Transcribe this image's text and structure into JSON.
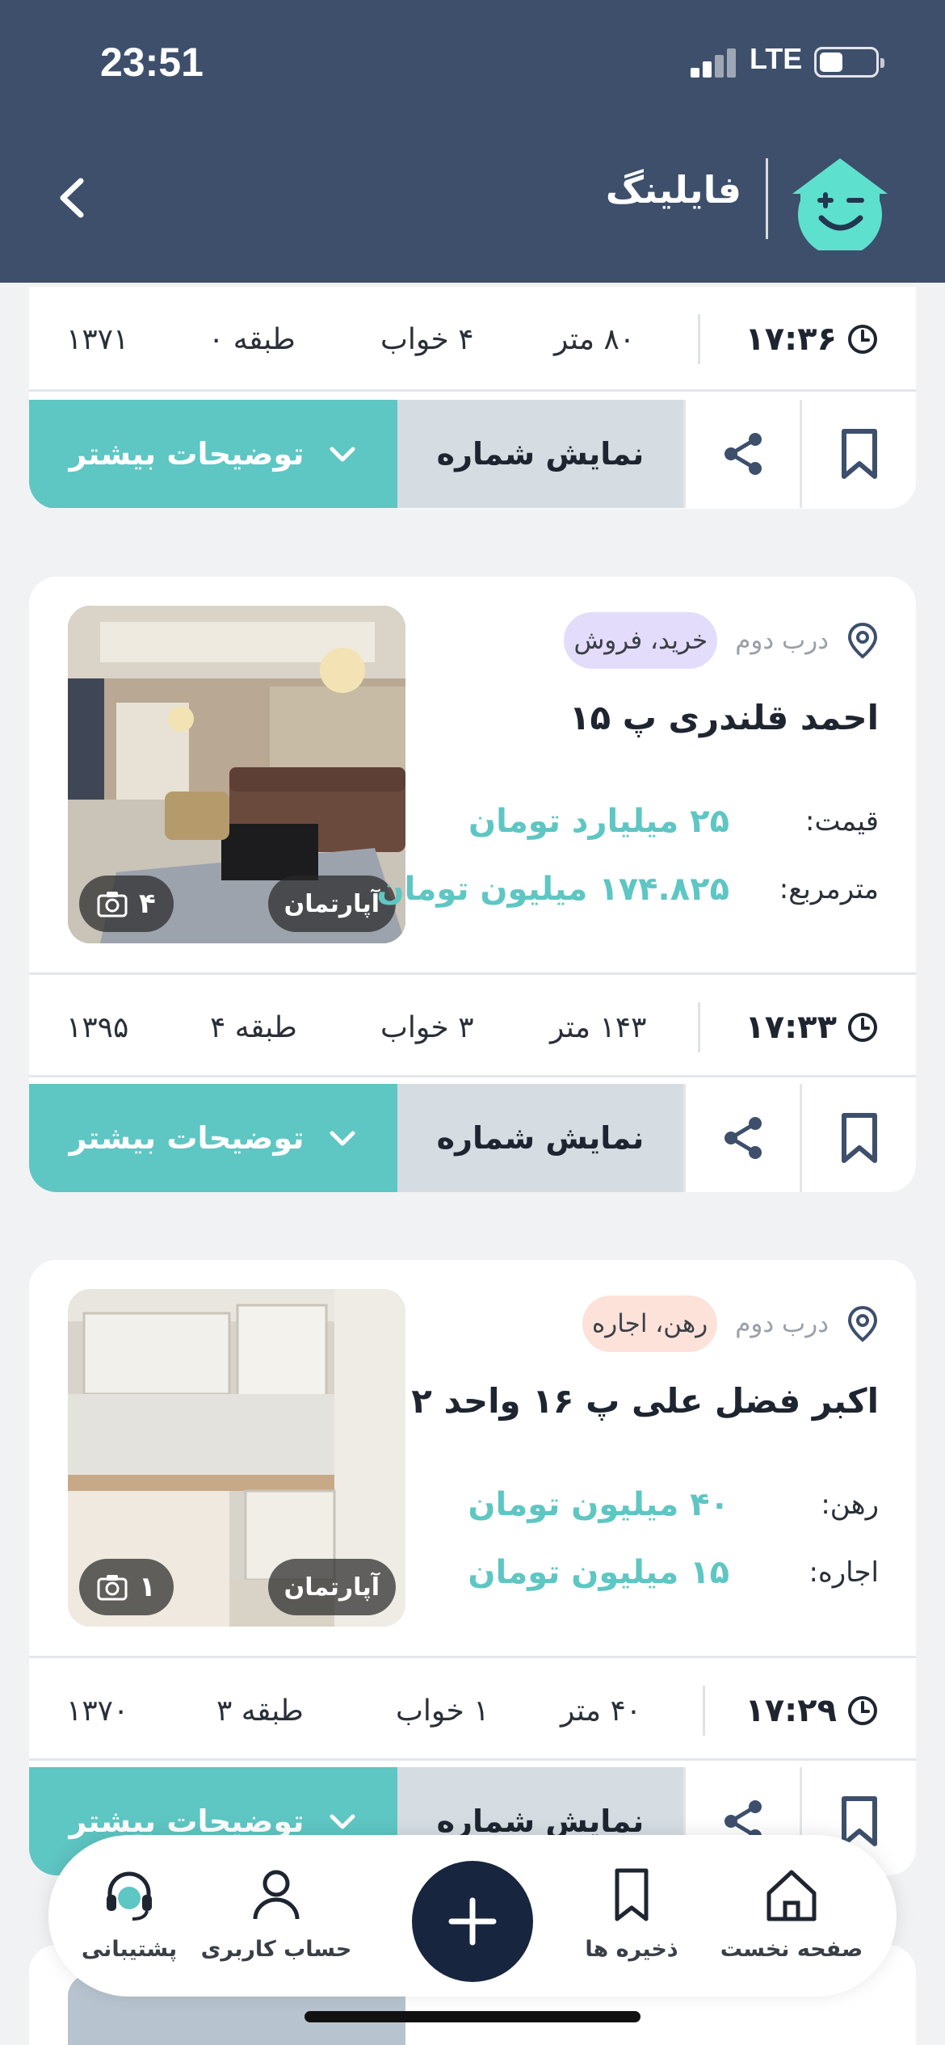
{
  "status_bar": {
    "time": "23:51",
    "network": "LTE"
  },
  "header": {
    "app_name": "فایلینگ"
  },
  "colors": {
    "header_bg": "#3d4f6b",
    "accent": "#5ec6c3",
    "phone_button_bg": "#d5dde3",
    "sale_tag_bg": "#e3dcfb",
    "rent_tag_bg": "#fde2da"
  },
  "listings": [
    {
      "time": "۱۷:۳۶",
      "area": "۸۰ متر",
      "rooms": "۴ خواب",
      "floor": "طبقه ۰",
      "year": "۱۳۷۱",
      "show_phone": "نمایش شماره",
      "more": "توضیحات بیشتر"
    },
    {
      "location": "درب دوم",
      "tag": "خرید، فروش",
      "title": "احمد قلندری پ ۱۵",
      "price_label_1": "قیمت:",
      "price_value_1": "۲۵ میلیارد تومان",
      "price_label_2": "مترمربع:",
      "price_value_2": "۱۷۴.۸۲۵ میلیون تومان",
      "photo_type": "آپارتمان",
      "photo_count": "۴",
      "time": "۱۷:۳۳",
      "area": "۱۴۳ متر",
      "rooms": "۳ خواب",
      "floor": "طبقه ۴",
      "year": "۱۳۹۵",
      "show_phone": "نمایش شماره",
      "more": "توضیحات بیشتر"
    },
    {
      "location": "درب دوم",
      "tag": "رهن، اجاره",
      "title": "اکبر فضل علی پ ۱۶ واحد ۲",
      "price_label_1": "رهن:",
      "price_value_1": "۴۰ میلیون تومان",
      "price_label_2": "اجاره:",
      "price_value_2": "۱۵ میلیون تومان",
      "photo_type": "آپارتمان",
      "photo_count": "۱",
      "time": "۱۷:۲۹",
      "area": "۴۰ متر",
      "rooms": "۱ خواب",
      "floor": "طبقه ۳",
      "year": "۱۳۷۰",
      "show_phone": "نمایش شماره",
      "more": "توضیحات بیشتر"
    }
  ],
  "bottom_nav": {
    "home": "صفحه نخست",
    "saved": "ذخیره ها",
    "account": "حساب کاربری",
    "support": "پشتیبانی"
  }
}
